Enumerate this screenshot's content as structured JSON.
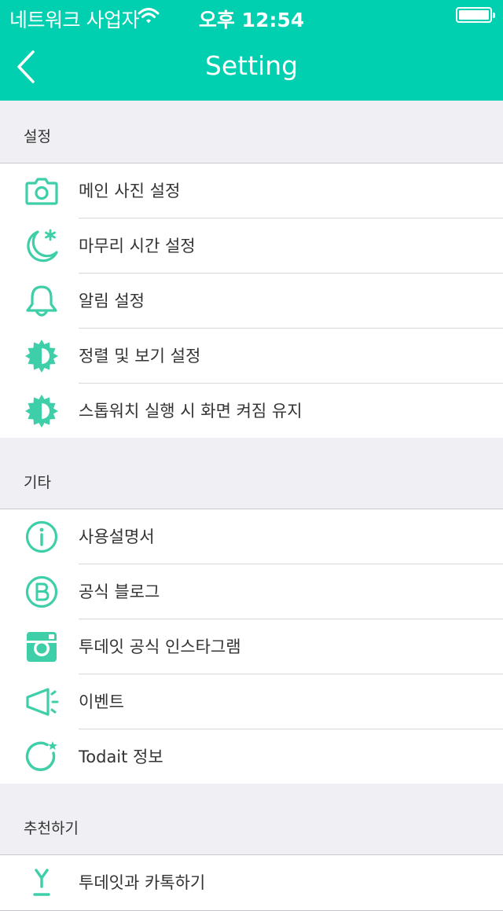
{
  "status_bar": {
    "carrier": "네트워크 사업자",
    "time": "오후 12:54"
  },
  "nav": {
    "title": "Setting"
  },
  "sections": [
    {
      "header": "설정",
      "items": [
        {
          "label": "메인 사진 설정",
          "icon": "camera-icon"
        },
        {
          "label": "마무리 시간 설정",
          "icon": "moon-star-icon"
        },
        {
          "label": "알림 설정",
          "icon": "bell-icon"
        },
        {
          "label": "정렬 및 보기 설정",
          "icon": "contrast-sun-icon"
        },
        {
          "label": "스톱워치 실행 시 화면 켜짐 유지",
          "icon": "contrast-sun-icon"
        }
      ]
    },
    {
      "header": "기타",
      "items": [
        {
          "label": "사용설명서",
          "icon": "info-icon"
        },
        {
          "label": "공식 블로그",
          "icon": "blog-b-icon"
        },
        {
          "label": "투데잇 공식 인스타그램",
          "icon": "instagram-icon"
        },
        {
          "label": "이벤트",
          "icon": "megaphone-icon"
        },
        {
          "label": "Todait 정보",
          "icon": "todait-logo-icon"
        }
      ]
    },
    {
      "header": "추천하기",
      "items": [
        {
          "label": "투데잇과 카톡하기",
          "icon": "kakao-icon"
        }
      ]
    }
  ],
  "colors": {
    "accent": "#00cfb0",
    "icon": "#3ecfa8",
    "background": "#efeff4"
  }
}
